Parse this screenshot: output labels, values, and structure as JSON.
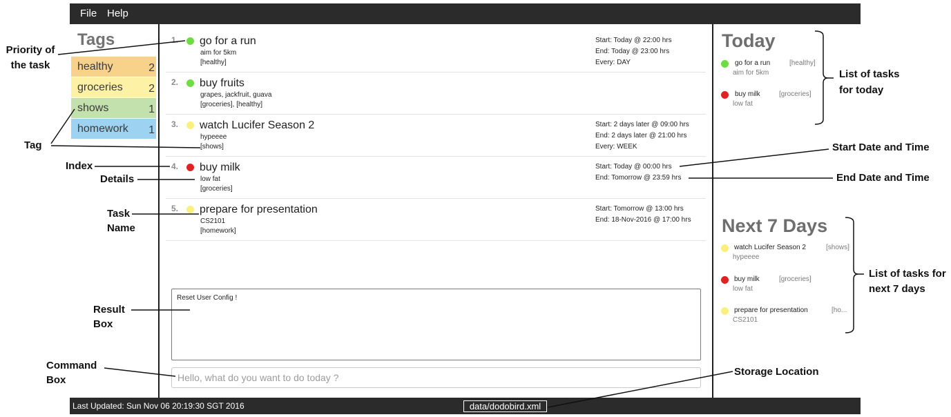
{
  "menu": {
    "file": "File",
    "help": "Help"
  },
  "tags_panel": {
    "title": "Tags",
    "tags": [
      {
        "name": "healthy",
        "count": "2",
        "color": "#f8d18b"
      },
      {
        "name": "groceries",
        "count": "2",
        "color": "#fdf1a6"
      },
      {
        "name": "shows",
        "count": "1",
        "color": "#c3e1ac"
      },
      {
        "name": "homework",
        "count": "1",
        "color": "#9dd3f1"
      }
    ]
  },
  "tasks": [
    {
      "index": "1.",
      "priority_color": "#6fdc45",
      "name": "go for a run",
      "details": "aim for 5km",
      "tags": "[healthy]",
      "start": "Start: Today @ 22:00 hrs",
      "end": "End: Today @ 23:00 hrs",
      "every": "Every: DAY"
    },
    {
      "index": "2.",
      "priority_color": "#6fdc45",
      "name": "buy fruits",
      "details": "grapes, jackfruit, guava",
      "tags": "[groceries], [healthy]"
    },
    {
      "index": "3.",
      "priority_color": "#fbf07f",
      "name": "watch Lucifer Season 2",
      "details": "hypeeee",
      "tags": "[shows]",
      "start": "Start: 2 days later @ 09:00 hrs",
      "end": "End: 2 days later @ 21:00 hrs",
      "every": "Every: WEEK"
    },
    {
      "index": "4.",
      "priority_color": "#df2222",
      "name": "buy milk",
      "details": "low fat",
      "tags": "[groceries]",
      "start": "Start: Today @ 00:00 hrs",
      "end": "End: Tomorrow @ 23:59 hrs"
    },
    {
      "index": "5.",
      "priority_color": "#fbf07f",
      "name": "prepare for presentation",
      "details": "CS2101",
      "tags": "[homework]",
      "start": "Start: Tomorrow @ 13:00 hrs",
      "end": "End: 18-Nov-2016 @ 17:00 hrs"
    }
  ],
  "result_box": {
    "text": "Reset User Config !"
  },
  "command_box": {
    "placeholder": "Hello, what do you want to do today ?"
  },
  "today": {
    "title": "Today",
    "items": [
      {
        "priority_color": "#6fdc45",
        "name": "go for a run",
        "tag": "[healthy]",
        "details": "aim for 5km"
      },
      {
        "priority_color": "#df2222",
        "name": "buy milk",
        "tag": "[groceries]",
        "details": "low fat"
      }
    ]
  },
  "next7": {
    "title": "Next 7 Days",
    "items": [
      {
        "priority_color": "#fbf07f",
        "name": "watch Lucifer Season 2",
        "tag": "[shows]",
        "details": "hypeeee"
      },
      {
        "priority_color": "#df2222",
        "name": "buy milk",
        "tag": "[groceries]",
        "details": "low fat"
      },
      {
        "priority_color": "#fbf07f",
        "name": "prepare for presentation",
        "tag": "[ho...",
        "details": "CS2101"
      }
    ]
  },
  "status_bar": {
    "last_updated": "Last Updated: Sun Nov 06 20:19:30 SGT 2016",
    "storage_path": "data/dodobird.xml"
  },
  "annotations": {
    "priority": [
      "Priority of",
      "the task"
    ],
    "tag": "Tag",
    "index": "Index",
    "details": "Details",
    "task_name": [
      "Task",
      "Name"
    ],
    "result_box": [
      "Result",
      "Box"
    ],
    "command_box": [
      "Command",
      "Box"
    ],
    "today_list": [
      "List of tasks",
      "for today"
    ],
    "start_datetime": "Start Date and Time",
    "end_datetime": "End Date and Time",
    "next7_list": [
      "List of tasks for",
      "next 7 days"
    ],
    "storage_location": "Storage Location"
  }
}
